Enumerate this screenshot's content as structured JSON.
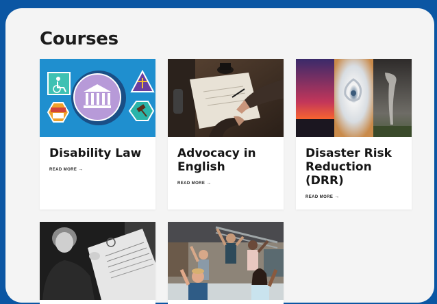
{
  "page": {
    "title": "Courses",
    "background_color": "#0b56a3",
    "panel_color": "#f4f4f4"
  },
  "courses": [
    {
      "title": "Disability Law",
      "read_more": "READ MORE",
      "arrow": "→",
      "image": "disability-law-icons-illustration"
    },
    {
      "title": "Advocacy in English",
      "read_more": "READ MORE",
      "arrow": "→",
      "image": "writing-on-paper-photo"
    },
    {
      "title": "Disaster Risk Reduction (DRR)",
      "read_more": "READ MORE",
      "arrow": "→",
      "image": "wildfire-hurricane-tornado-photo"
    },
    {
      "title": "",
      "read_more": "",
      "arrow": "",
      "image": "human-rights-declaration-photo"
    },
    {
      "title": "",
      "read_more": "",
      "arrow": "",
      "image": "celebrating-group-photo"
    }
  ]
}
